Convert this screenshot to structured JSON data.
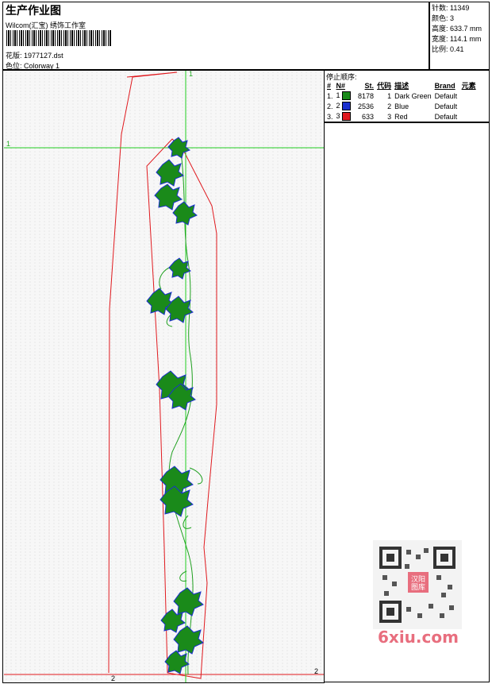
{
  "header": {
    "title": "生产作业图",
    "company": "Wilcom(汇宝) 绣饰工作室",
    "design_file_label": "花版:",
    "design_file": "1977127.dst",
    "colorway_label": "色位:",
    "colorway": "Colorway 1"
  },
  "stats": [
    {
      "label": "针数:",
      "value": "11349"
    },
    {
      "label": "颜色:",
      "value": "3"
    },
    {
      "label": "高度:",
      "value": "633.7 mm"
    },
    {
      "label": "宽度:",
      "value": "114.1 mm"
    },
    {
      "label": "比例:",
      "value": "0.41"
    }
  ],
  "stop_sequence_label": "停止顺序:",
  "color_table": {
    "headers": [
      "#",
      "N#",
      "St.",
      "代码",
      "描述",
      "Brand",
      "元素"
    ],
    "rows": [
      {
        "idx": "1.",
        "n": "1",
        "color": "#1a8a1a",
        "st": "8178",
        "code": "1",
        "desc": "Dark Green",
        "brand": "Default"
      },
      {
        "idx": "2.",
        "n": "2",
        "color": "#1a2fd0",
        "st": "2536",
        "code": "2",
        "desc": "Blue",
        "brand": "Default"
      },
      {
        "idx": "3.",
        "n": "3",
        "color": "#e0191e",
        "st": "633",
        "code": "3",
        "desc": "Red",
        "brand": "Default"
      }
    ]
  },
  "guides": {
    "h_label_left": "1",
    "v_label_top": "1",
    "bottom_label_1": "2",
    "bottom_label_2": "2"
  },
  "watermark": {
    "text": "6xiu.com",
    "qr_center": "汉阳图库"
  },
  "colors": {
    "green": "#1a8a1a",
    "blue": "#1a2fd0",
    "red": "#e0191e",
    "guide": "#22cc22"
  }
}
